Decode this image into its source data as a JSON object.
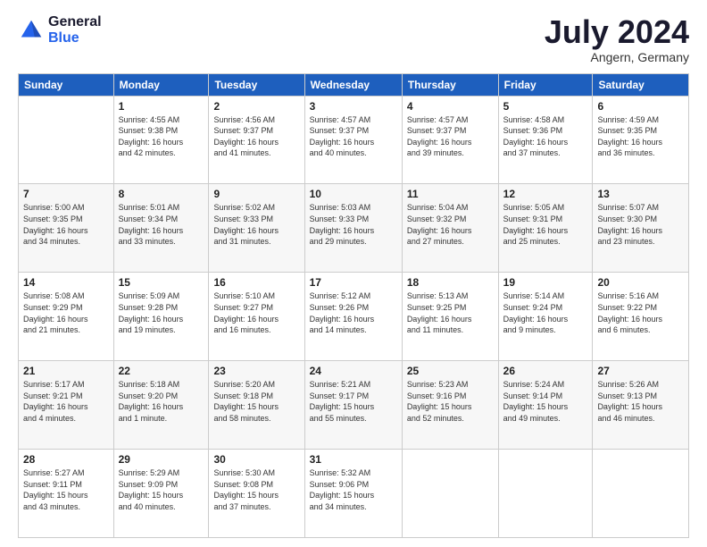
{
  "logo": {
    "text1": "General",
    "text2": "Blue"
  },
  "header": {
    "month": "July 2024",
    "location": "Angern, Germany"
  },
  "weekdays": [
    "Sunday",
    "Monday",
    "Tuesday",
    "Wednesday",
    "Thursday",
    "Friday",
    "Saturday"
  ],
  "weeks": [
    [
      {
        "day": "",
        "info": ""
      },
      {
        "day": "1",
        "info": "Sunrise: 4:55 AM\nSunset: 9:38 PM\nDaylight: 16 hours\nand 42 minutes."
      },
      {
        "day": "2",
        "info": "Sunrise: 4:56 AM\nSunset: 9:37 PM\nDaylight: 16 hours\nand 41 minutes."
      },
      {
        "day": "3",
        "info": "Sunrise: 4:57 AM\nSunset: 9:37 PM\nDaylight: 16 hours\nand 40 minutes."
      },
      {
        "day": "4",
        "info": "Sunrise: 4:57 AM\nSunset: 9:37 PM\nDaylight: 16 hours\nand 39 minutes."
      },
      {
        "day": "5",
        "info": "Sunrise: 4:58 AM\nSunset: 9:36 PM\nDaylight: 16 hours\nand 37 minutes."
      },
      {
        "day": "6",
        "info": "Sunrise: 4:59 AM\nSunset: 9:35 PM\nDaylight: 16 hours\nand 36 minutes."
      }
    ],
    [
      {
        "day": "7",
        "info": "Sunrise: 5:00 AM\nSunset: 9:35 PM\nDaylight: 16 hours\nand 34 minutes."
      },
      {
        "day": "8",
        "info": "Sunrise: 5:01 AM\nSunset: 9:34 PM\nDaylight: 16 hours\nand 33 minutes."
      },
      {
        "day": "9",
        "info": "Sunrise: 5:02 AM\nSunset: 9:33 PM\nDaylight: 16 hours\nand 31 minutes."
      },
      {
        "day": "10",
        "info": "Sunrise: 5:03 AM\nSunset: 9:33 PM\nDaylight: 16 hours\nand 29 minutes."
      },
      {
        "day": "11",
        "info": "Sunrise: 5:04 AM\nSunset: 9:32 PM\nDaylight: 16 hours\nand 27 minutes."
      },
      {
        "day": "12",
        "info": "Sunrise: 5:05 AM\nSunset: 9:31 PM\nDaylight: 16 hours\nand 25 minutes."
      },
      {
        "day": "13",
        "info": "Sunrise: 5:07 AM\nSunset: 9:30 PM\nDaylight: 16 hours\nand 23 minutes."
      }
    ],
    [
      {
        "day": "14",
        "info": "Sunrise: 5:08 AM\nSunset: 9:29 PM\nDaylight: 16 hours\nand 21 minutes."
      },
      {
        "day": "15",
        "info": "Sunrise: 5:09 AM\nSunset: 9:28 PM\nDaylight: 16 hours\nand 19 minutes."
      },
      {
        "day": "16",
        "info": "Sunrise: 5:10 AM\nSunset: 9:27 PM\nDaylight: 16 hours\nand 16 minutes."
      },
      {
        "day": "17",
        "info": "Sunrise: 5:12 AM\nSunset: 9:26 PM\nDaylight: 16 hours\nand 14 minutes."
      },
      {
        "day": "18",
        "info": "Sunrise: 5:13 AM\nSunset: 9:25 PM\nDaylight: 16 hours\nand 11 minutes."
      },
      {
        "day": "19",
        "info": "Sunrise: 5:14 AM\nSunset: 9:24 PM\nDaylight: 16 hours\nand 9 minutes."
      },
      {
        "day": "20",
        "info": "Sunrise: 5:16 AM\nSunset: 9:22 PM\nDaylight: 16 hours\nand 6 minutes."
      }
    ],
    [
      {
        "day": "21",
        "info": "Sunrise: 5:17 AM\nSunset: 9:21 PM\nDaylight: 16 hours\nand 4 minutes."
      },
      {
        "day": "22",
        "info": "Sunrise: 5:18 AM\nSunset: 9:20 PM\nDaylight: 16 hours\nand 1 minute."
      },
      {
        "day": "23",
        "info": "Sunrise: 5:20 AM\nSunset: 9:18 PM\nDaylight: 15 hours\nand 58 minutes."
      },
      {
        "day": "24",
        "info": "Sunrise: 5:21 AM\nSunset: 9:17 PM\nDaylight: 15 hours\nand 55 minutes."
      },
      {
        "day": "25",
        "info": "Sunrise: 5:23 AM\nSunset: 9:16 PM\nDaylight: 15 hours\nand 52 minutes."
      },
      {
        "day": "26",
        "info": "Sunrise: 5:24 AM\nSunset: 9:14 PM\nDaylight: 15 hours\nand 49 minutes."
      },
      {
        "day": "27",
        "info": "Sunrise: 5:26 AM\nSunset: 9:13 PM\nDaylight: 15 hours\nand 46 minutes."
      }
    ],
    [
      {
        "day": "28",
        "info": "Sunrise: 5:27 AM\nSunset: 9:11 PM\nDaylight: 15 hours\nand 43 minutes."
      },
      {
        "day": "29",
        "info": "Sunrise: 5:29 AM\nSunset: 9:09 PM\nDaylight: 15 hours\nand 40 minutes."
      },
      {
        "day": "30",
        "info": "Sunrise: 5:30 AM\nSunset: 9:08 PM\nDaylight: 15 hours\nand 37 minutes."
      },
      {
        "day": "31",
        "info": "Sunrise: 5:32 AM\nSunset: 9:06 PM\nDaylight: 15 hours\nand 34 minutes."
      },
      {
        "day": "",
        "info": ""
      },
      {
        "day": "",
        "info": ""
      },
      {
        "day": "",
        "info": ""
      }
    ]
  ]
}
